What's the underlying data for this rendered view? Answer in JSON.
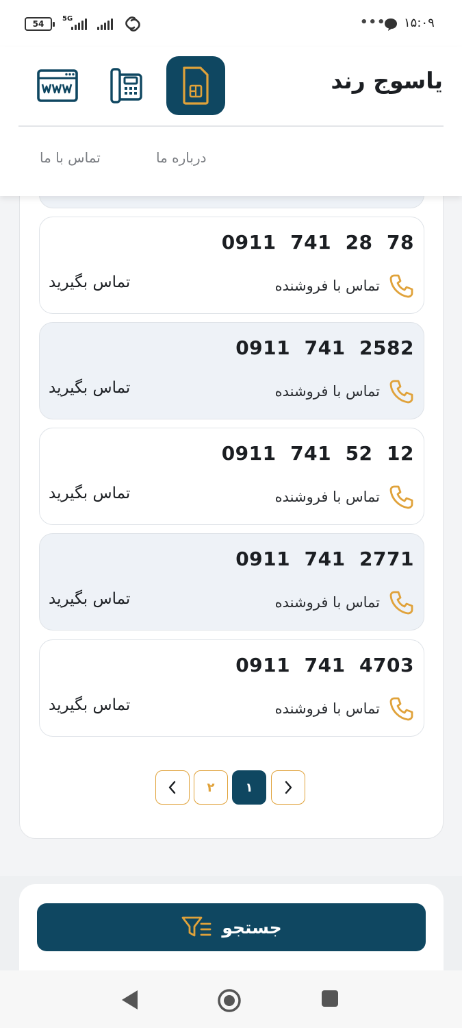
{
  "status_bar": {
    "battery": "54",
    "network": "5G",
    "time": "۱۵:۰۹",
    "more": "•••"
  },
  "header": {
    "brand": "یاسوج رند",
    "icons": [
      "sim-card-icon",
      "office-phone-icon",
      "www-icon"
    ],
    "nav": {
      "about": "درباره ما",
      "contact": "تماس با ما"
    }
  },
  "listings": [
    {
      "number": "0911  741  28  78",
      "seller_label": "تماس با فروشنده",
      "call_label": "تماس بگیرید"
    },
    {
      "number": "0911  741  2582",
      "seller_label": "تماس با فروشنده",
      "call_label": "تماس بگیرید"
    },
    {
      "number": "0911  741  52  12",
      "seller_label": "تماس با فروشنده",
      "call_label": "تماس بگیرید"
    },
    {
      "number": "0911  741  2771",
      "seller_label": "تماس با فروشنده",
      "call_label": "تماس بگیرید"
    },
    {
      "number": "0911  741  4703",
      "seller_label": "تماس با فروشنده",
      "call_label": "تماس بگیرید"
    }
  ],
  "pagination": {
    "pages": [
      "۲",
      "۱"
    ],
    "current": "۱"
  },
  "search": {
    "label": "جستجو"
  },
  "colors": {
    "primary": "#0f4761",
    "accent": "#e0a23a",
    "alt_card": "#eef2f7"
  }
}
